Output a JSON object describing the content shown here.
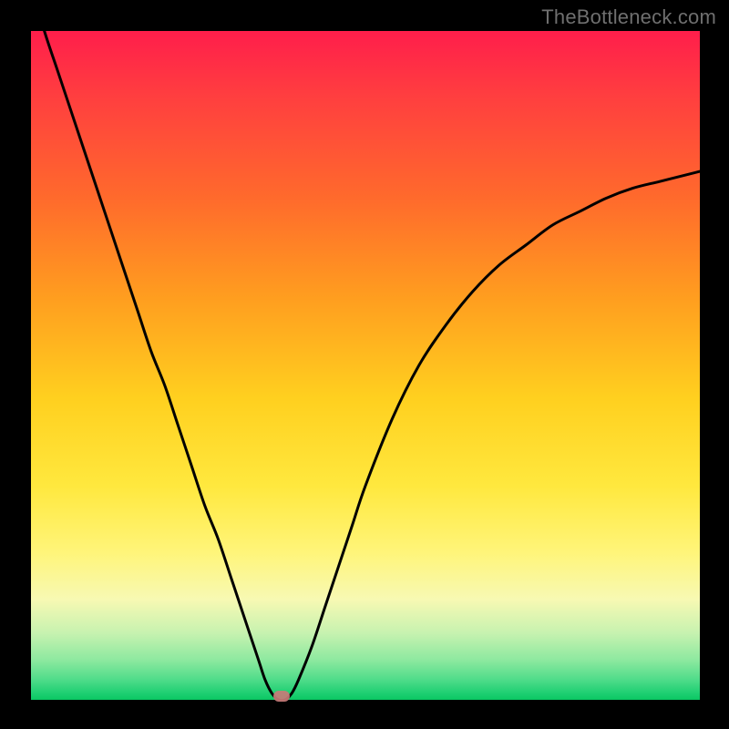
{
  "watermark": "TheBottleneck.com",
  "chart_data": {
    "type": "line",
    "title": "",
    "xlabel": "",
    "ylabel": "",
    "xlim": [
      0,
      100
    ],
    "ylim": [
      0,
      100
    ],
    "grid": false,
    "legend": false,
    "series": [
      {
        "name": "bottleneck-curve",
        "x": [
          0,
          2,
          4,
          6,
          8,
          10,
          12,
          14,
          16,
          18,
          20,
          22,
          24,
          26,
          28,
          30,
          32,
          34,
          35,
          36,
          37,
          38,
          39,
          40,
          42,
          44,
          46,
          48,
          50,
          54,
          58,
          62,
          66,
          70,
          74,
          78,
          82,
          86,
          90,
          94,
          98,
          100
        ],
        "y": [
          107,
          100,
          94,
          88,
          82,
          76,
          70,
          64,
          58,
          52,
          47,
          41,
          35,
          29,
          24,
          18,
          12,
          6,
          3,
          1,
          0,
          0,
          1,
          3,
          8,
          14,
          20,
          26,
          32,
          42,
          50,
          56,
          61,
          65,
          68,
          71,
          73,
          75,
          76.5,
          77.5,
          78.5,
          79
        ]
      }
    ],
    "marker": {
      "x": 37.5,
      "y": 0.5,
      "label": "optimal-point"
    },
    "background_gradient": {
      "stops": [
        {
          "pos": 0,
          "color": "#ff1e4b"
        },
        {
          "pos": 25,
          "color": "#ff6a2c"
        },
        {
          "pos": 55,
          "color": "#ffd01f"
        },
        {
          "pos": 78,
          "color": "#fff57a"
        },
        {
          "pos": 90,
          "color": "#c7f2b0"
        },
        {
          "pos": 100,
          "color": "#0bc763"
        }
      ]
    }
  }
}
